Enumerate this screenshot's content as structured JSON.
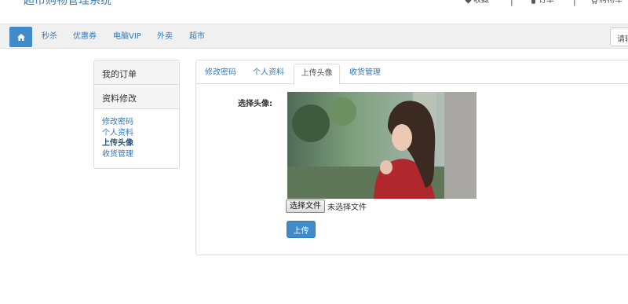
{
  "header": {
    "site_title": "超市购物管理系统",
    "links": [
      {
        "label": "收藏",
        "icon": "heart-icon"
      },
      {
        "label": "订单",
        "icon": "file-icon"
      },
      {
        "label": "购物车",
        "icon": "cart-icon"
      }
    ]
  },
  "nav": {
    "home_icon": "home-icon",
    "items": [
      "秒杀",
      "优惠券",
      "电脑VIP",
      "外卖",
      "超市"
    ],
    "search_placeholder": "请输入"
  },
  "sidebar": {
    "orders_label": "我的订单",
    "profile_label": "资料修改",
    "sub_items": [
      "修改密码",
      "个人资料",
      "上传头像",
      "收货管理"
    ],
    "active_sub": "上传头像"
  },
  "tabs": {
    "items": [
      "修改密码",
      "个人资料",
      "上传头像",
      "收货管理"
    ],
    "active": "上传头像"
  },
  "form": {
    "avatar_label": "选择头像:",
    "file_button": "选择文件",
    "file_status": "未选择文件",
    "upload_button": "上传"
  },
  "colors": {
    "accent": "#428bca",
    "link": "#337ab7"
  }
}
